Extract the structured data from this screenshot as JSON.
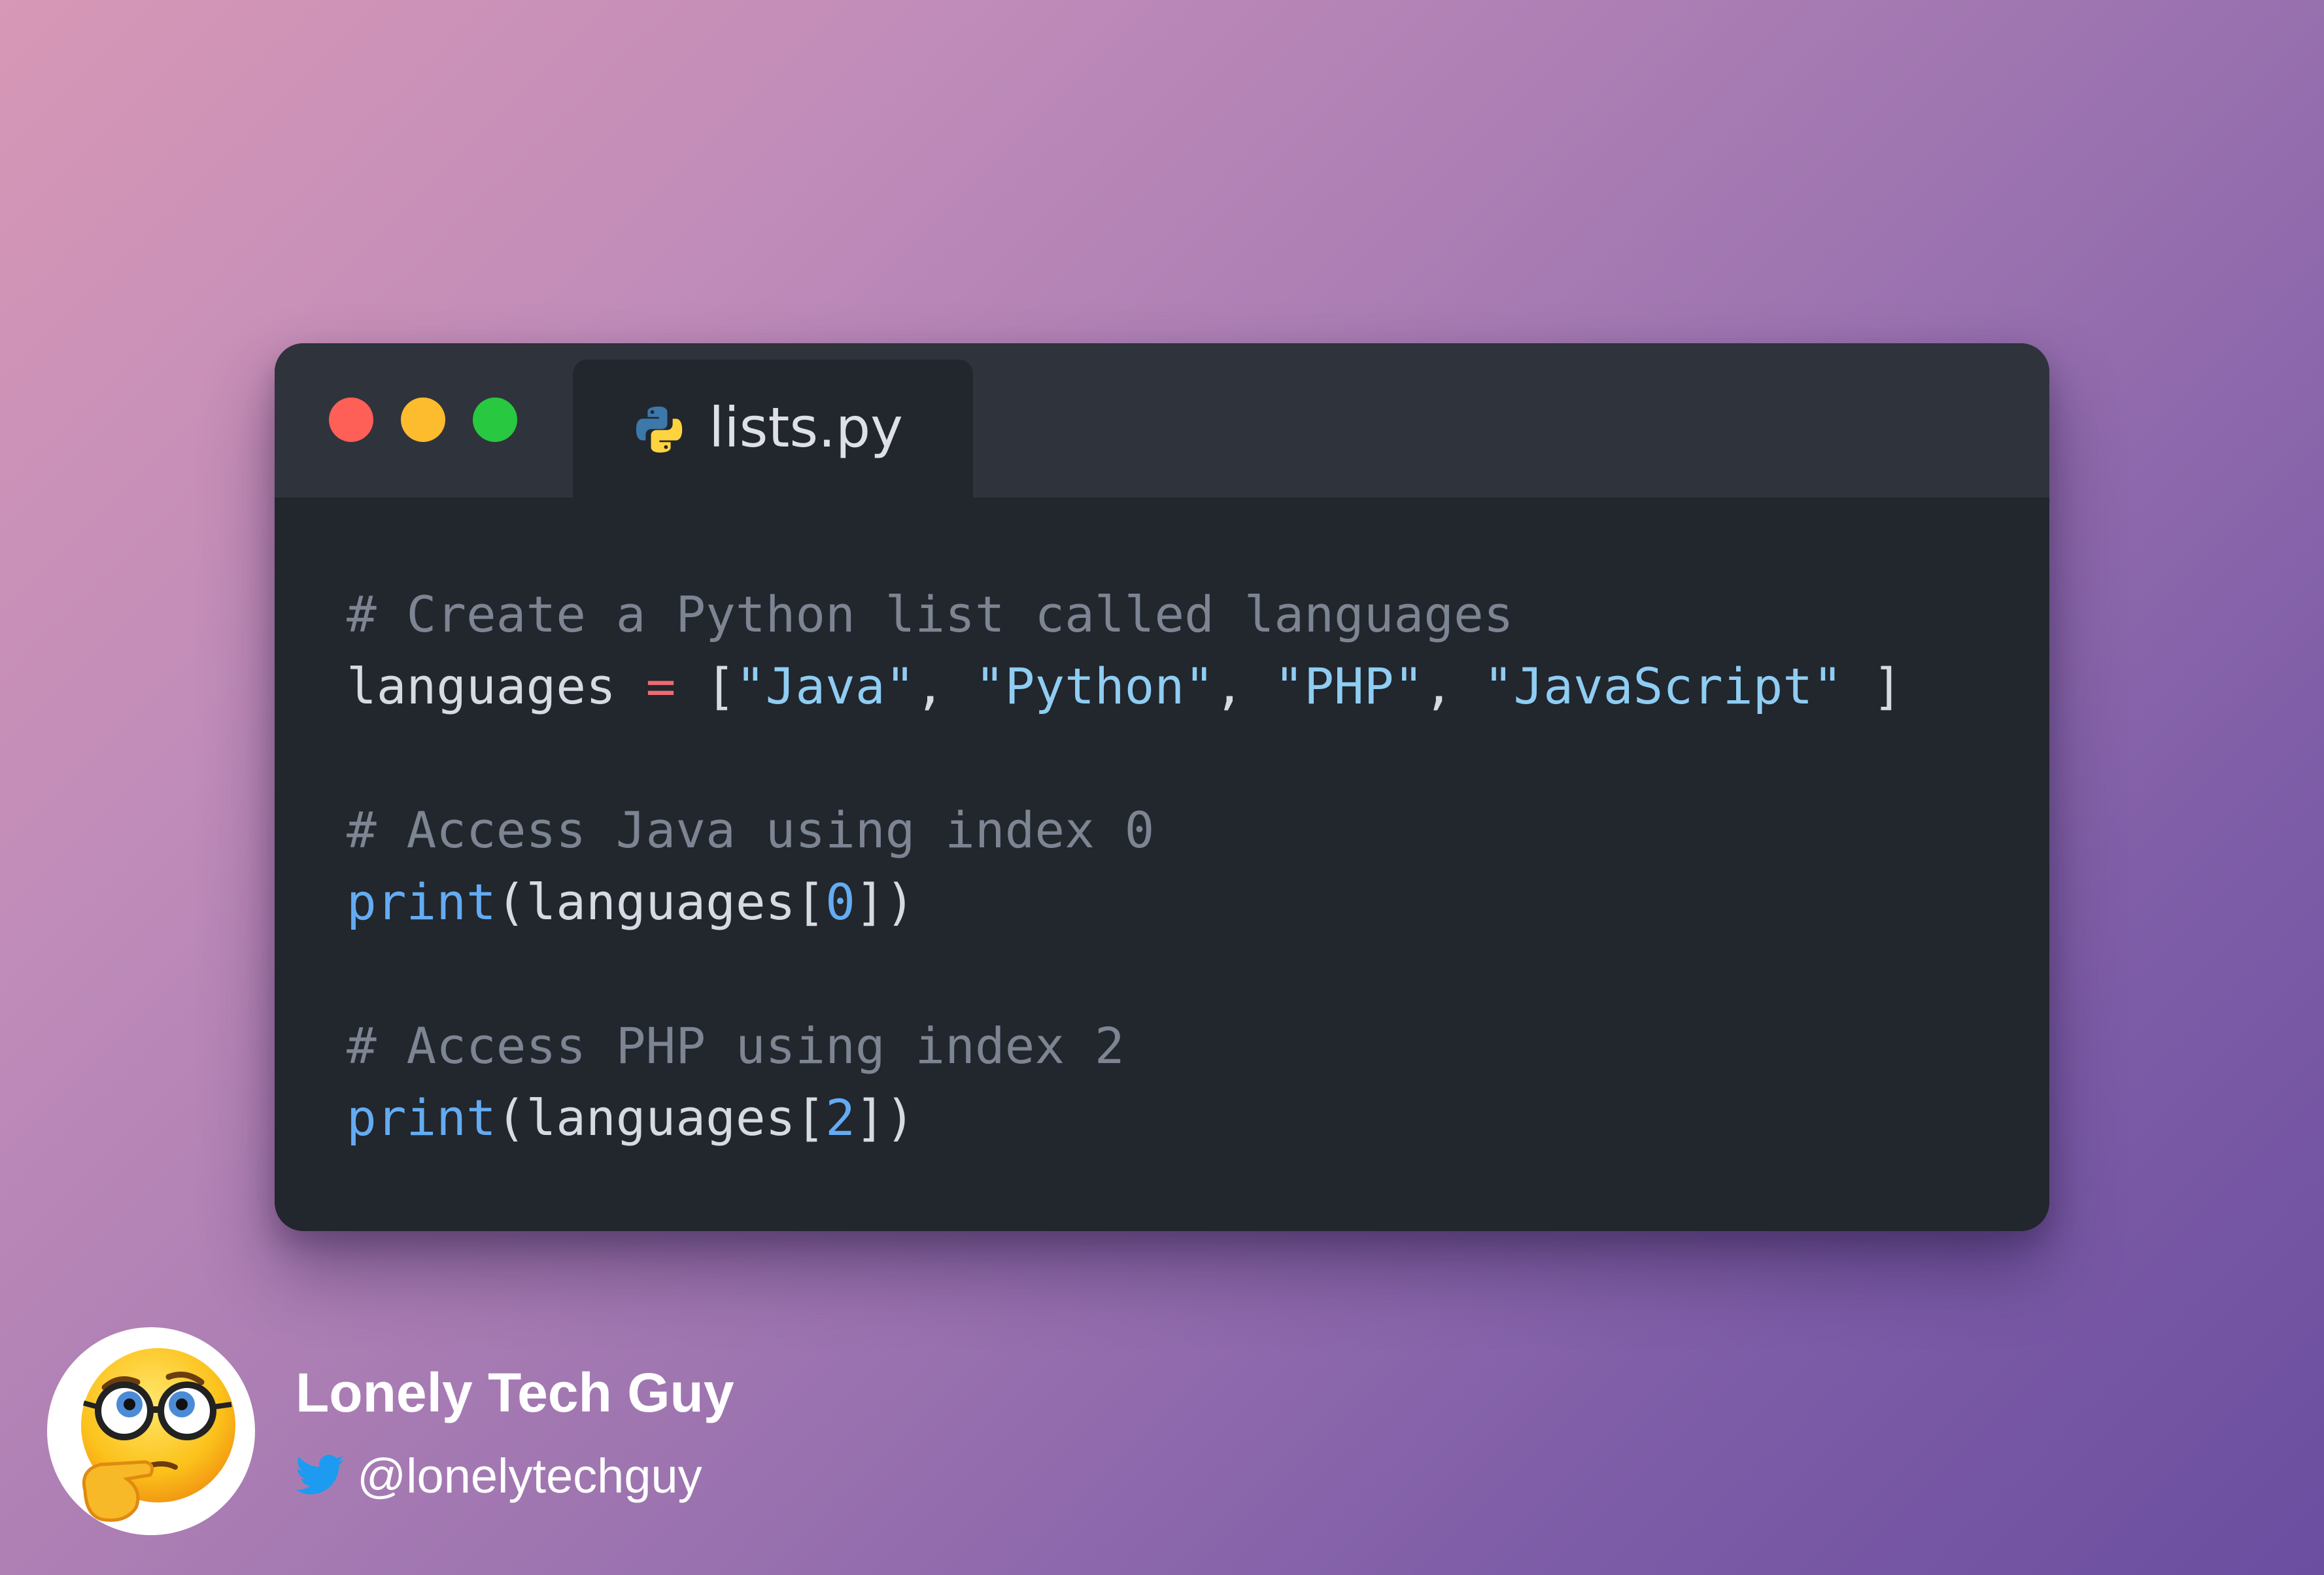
{
  "window": {
    "traffic_lights": [
      "close",
      "minimize",
      "maximize"
    ],
    "colors": {
      "close": "#fe5f57",
      "minimize": "#fdbc2d",
      "maximize": "#28c840",
      "background": "#22262d",
      "titlebar": "#2f333c"
    }
  },
  "tab": {
    "icon": "python-icon",
    "filename": "lists.py"
  },
  "code": {
    "language": "python",
    "lines": [
      [
        {
          "t": "# Create a Python list called languages",
          "k": "comment"
        }
      ],
      [
        {
          "t": "languages ",
          "k": "plain"
        },
        {
          "t": "=",
          "k": "op"
        },
        {
          "t": " [",
          "k": "plain"
        },
        {
          "t": "\"Java\"",
          "k": "str"
        },
        {
          "t": ", ",
          "k": "plain"
        },
        {
          "t": "\"Python\"",
          "k": "str"
        },
        {
          "t": ", ",
          "k": "plain"
        },
        {
          "t": "\"PHP\"",
          "k": "str"
        },
        {
          "t": ", ",
          "k": "plain"
        },
        {
          "t": "\"JavaScript\"",
          "k": "str"
        },
        {
          "t": " ]",
          "k": "plain"
        }
      ],
      [],
      [
        {
          "t": "# Access Java using index 0",
          "k": "comment"
        }
      ],
      [
        {
          "t": "print",
          "k": "fn"
        },
        {
          "t": "(languages[",
          "k": "plain"
        },
        {
          "t": "0",
          "k": "num"
        },
        {
          "t": "])",
          "k": "plain"
        }
      ],
      [],
      [
        {
          "t": "# Access PHP using index 2",
          "k": "comment"
        }
      ],
      [
        {
          "t": "print",
          "k": "fn"
        },
        {
          "t": "(languages[",
          "k": "plain"
        },
        {
          "t": "2",
          "k": "num"
        },
        {
          "t": "])",
          "k": "plain"
        }
      ]
    ]
  },
  "author": {
    "avatar_icon": "nerd-face-thinking-emoji",
    "name": "Lonely Tech Guy",
    "handle_icon": "twitter-bird-icon",
    "handle": "@lonelytechguy",
    "handle_icon_color": "#1d9bf0"
  }
}
